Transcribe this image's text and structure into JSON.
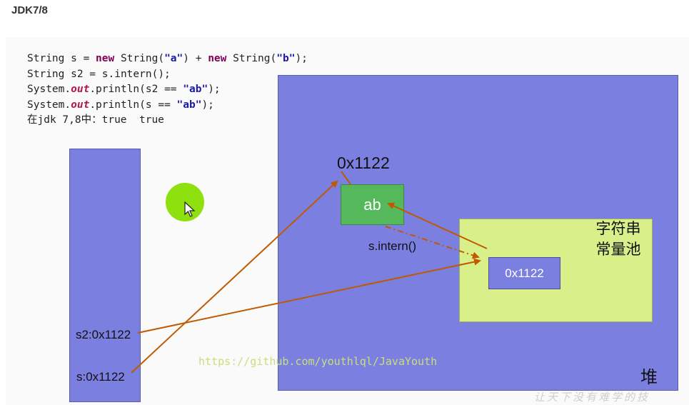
{
  "heading": "JDK7/8",
  "code": {
    "line1": {
      "a": "String s = ",
      "kw1": "new",
      "b": " String(",
      "s1": "\"a\"",
      "c": ") + ",
      "kw2": "new",
      "d": " String(",
      "s2": "\"b\"",
      "e": ");"
    },
    "line2": "String s2 = s.intern();",
    "line3": {
      "a": "System.",
      "fld": "out",
      "b": ".println(s2 == ",
      "s": "\"ab\"",
      "c": ");"
    },
    "line4": {
      "a": "System.",
      "fld": "out",
      "b": ".println(s == ",
      "s": "\"ab\"",
      "c": ");"
    },
    "line5": "在jdk 7,8中：true  true"
  },
  "diagram": {
    "heap_object_address": "0x1122",
    "heap_object_value": "ab",
    "intern_label": "s.intern()",
    "string_pool_label_line1": "字符串",
    "string_pool_label_line2": "常量池",
    "pool_entry": "0x1122",
    "heap_label": "堆",
    "stack_vars": [
      "s2:0x1122",
      "s:0x1122"
    ]
  },
  "watermark": "https://github.com/youthlql/JavaYouth",
  "corner_mark": "让天下没有难学的技",
  "colors": {
    "region_blue": "#7b7fe0",
    "object_green": "#55b85a",
    "pool_yellow": "#d9ef8a",
    "arrow_orange": "#c05a00",
    "cursor_green": "#8fe00f"
  }
}
